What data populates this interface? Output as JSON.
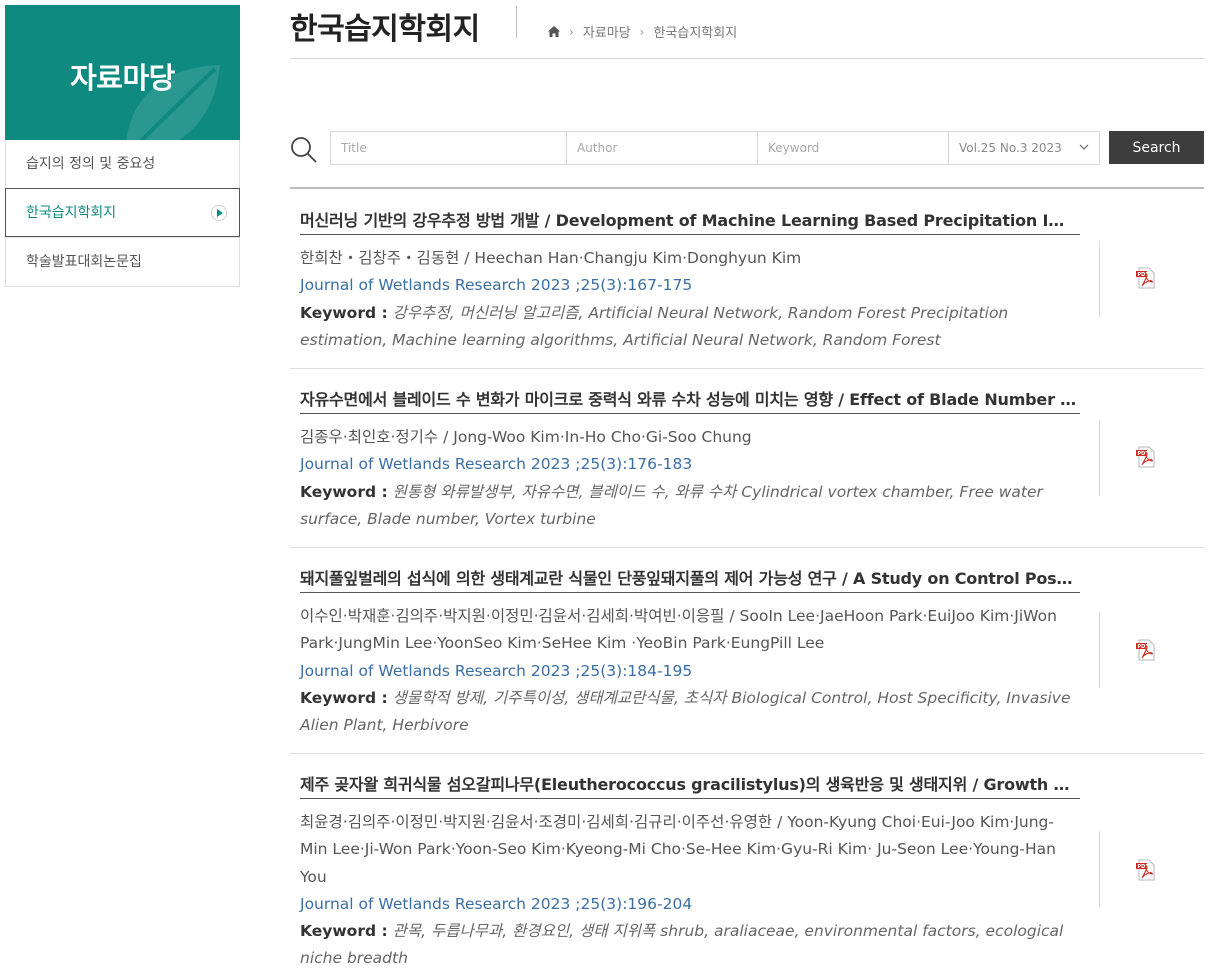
{
  "sidebar": {
    "title": "자료마당",
    "items": [
      {
        "label": "습지의 정의 및 중요성",
        "active": false
      },
      {
        "label": "한국습지학회지",
        "active": true
      },
      {
        "label": "학술발표대회논문집",
        "active": false
      }
    ]
  },
  "header": {
    "title": "한국습지학회지",
    "breadcrumb": [
      "자료마당",
      "한국습지학회지"
    ]
  },
  "search": {
    "title_placeholder": "Title",
    "author_placeholder": "Author",
    "keyword_placeholder": "Keyword",
    "volume_selected": "Vol.25 No.3 2023",
    "button_label": "Search"
  },
  "keyword_label": "Keyword :",
  "articles": [
    {
      "title": "머신러닝 기반의 강우추정 방법 개발 / Development of Machine Learning Based Precipitation Imputation Method",
      "authors": "한희찬・김창주・김동현 / Heechan Han·Changju Kim·Donghyun Kim",
      "journal": "Journal of Wetlands Research 2023 ;25(3):167-175",
      "keywords": "강우추정, 머신러닝 알고리즘, Artificial Neural Network, Random Forest Precipitation estimation, Machine learning algorithms, Artificial Neural Network, Random Forest"
    },
    {
      "title": "자유수면에서 블레이드 수 변화가 마이크로 중력식 와류 수차 성능에 미치는 영향 / Effect of Blade Number on the Performance",
      "authors": "김종우·최인호·정기수 / Jong-Woo Kim·In-Ho Cho·Gi-Soo Chung",
      "journal": "Journal of Wetlands Research 2023 ;25(3):176-183",
      "keywords": "원통형 와류발생부, 자유수면, 블레이드 수, 와류 수차 Cylindrical vortex chamber, Free water surface, Blade number, Vortex turbine"
    },
    {
      "title": "돼지풀잎벌레의 섭식에 의한 생태계교란 식물인 단풍잎돼지풀의 제어 가능성 연구 / A Study on Control Possibility",
      "authors": "이수인·박재훈·김의주·박지원·이정민·김윤서·김세희·박여빈·이응필 / SooIn Lee·JaeHoon Park·EuiJoo Kim·JiWon Park·JungMin Lee·YoonSeo Kim·SeHee Kim ·YeoBin Park·EungPill Lee",
      "journal": "Journal of Wetlands Research 2023 ;25(3):184-195",
      "keywords": "생물학적 방제, 기주특이성, 생태계교란식물, 초식자 Biological Control, Host Specificity, Invasive Alien Plant, Herbivore"
    },
    {
      "title": "제주 곶자왈 희귀식물 섬오갈피나무(Eleutherococcus gracilistylus)의 생육반응 및 생태지위 / Growth Response and Ecological Niche",
      "authors": "최윤경·김의주·이정민·박지원·김윤서·조경미·김세희·김규리·이주선·유영한 / Yoon-Kyung Choi·Eui-Joo Kim·Jung-Min Lee·Ji-Won Park·Yoon-Seo Kim·Kyeong-Mi Cho·Se-Hee Kim·Gyu-Ri Kim· Ju-Seon Lee·Young-Han You",
      "journal": "Journal of Wetlands Research 2023 ;25(3):196-204",
      "keywords": "관목, 두릅나무과, 환경요인, 생태 지위폭 shrub, araliaceae, environmental factors, ecological niche breadth"
    }
  ]
}
